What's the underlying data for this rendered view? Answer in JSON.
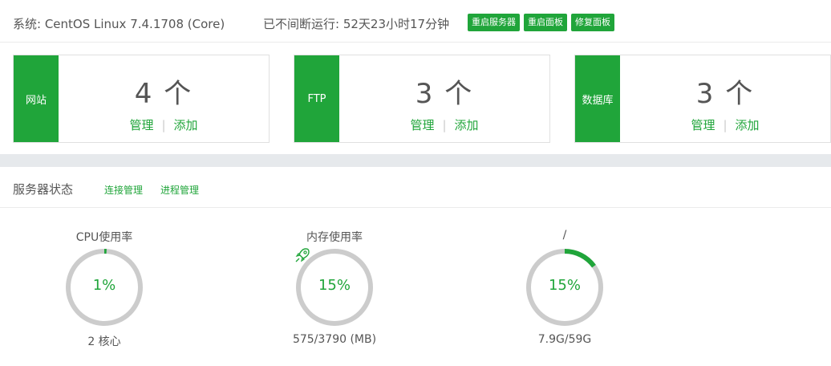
{
  "system": {
    "os_text": "系统: CentOS Linux 7.4.1708 (Core)",
    "uptime_text": "已不间断运行: 52天23小时17分钟",
    "buttons": [
      "重启服务器",
      "重启面板",
      "修复面板"
    ]
  },
  "cards": [
    {
      "label": "网站",
      "count": "4 个",
      "manage": "管理",
      "add": "添加",
      "sep": "|"
    },
    {
      "label": "FTP",
      "count": "3 个",
      "manage": "管理",
      "add": "添加",
      "sep": "|"
    },
    {
      "label": "数据库",
      "count": "3 个",
      "manage": "管理",
      "add": "添加",
      "sep": "|"
    }
  ],
  "server_status": {
    "title": "服务器状态",
    "links": [
      "连接管理",
      "进程管理"
    ]
  },
  "gauges": [
    {
      "title": "CPU使用率",
      "value_text": "1%",
      "percent": 1,
      "sub": "2 核心",
      "icon": null
    },
    {
      "title": "内存使用率",
      "value_text": "15%",
      "percent": 15,
      "sub": "575/3790 (MB)",
      "icon": "rocket-icon"
    },
    {
      "title": "/",
      "value_text": "15%",
      "percent": 15,
      "sub": "7.9G/59G",
      "icon": null
    }
  ],
  "colors": {
    "accent": "#20a53a",
    "track": "#cccccc"
  }
}
